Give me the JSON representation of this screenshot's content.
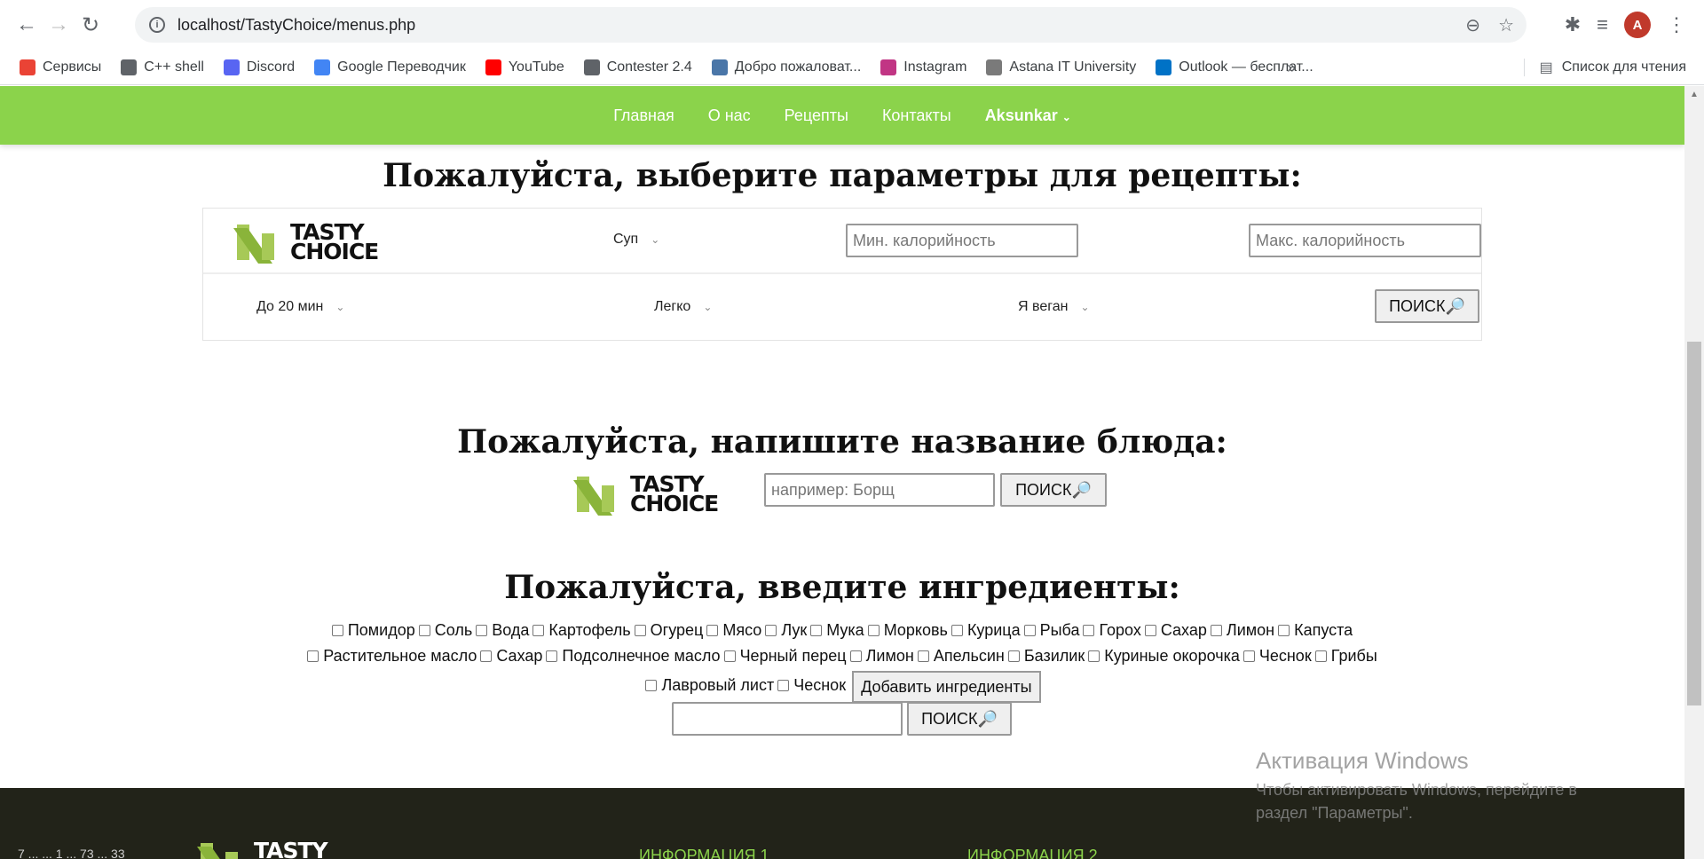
{
  "browser": {
    "url": "localhost/TastyChoice/menus.php",
    "bookmarks": [
      {
        "label": "Сервисы",
        "icon": "apps-grid-icon",
        "color": "#ea4335"
      },
      {
        "label": "C++ shell",
        "icon": "globe-icon",
        "color": "#5f6368"
      },
      {
        "label": "Discord",
        "icon": "discord-icon",
        "color": "#5865f2"
      },
      {
        "label": "Google Переводчик",
        "icon": "google-translate-icon",
        "color": "#4285f4"
      },
      {
        "label": "YouTube",
        "icon": "youtube-icon",
        "color": "#ff0000"
      },
      {
        "label": "Contester 2.4",
        "icon": "globe-icon",
        "color": "#5f6368"
      },
      {
        "label": "Добро пожаловат...",
        "icon": "vk-icon",
        "color": "#4a76a8"
      },
      {
        "label": "Instagram",
        "icon": "instagram-icon",
        "color": "#c13584"
      },
      {
        "label": "Astana IT University",
        "icon": "university-icon",
        "color": "#7a7a7a"
      },
      {
        "label": "Outlook — бесплат...",
        "icon": "outlook-icon",
        "color": "#0072c6"
      }
    ],
    "more": "»",
    "reading_list": "Список для чтения",
    "avatar_letter": "A"
  },
  "nav": {
    "items": [
      "Главная",
      "О нас",
      "Рецепты",
      "Контакты"
    ],
    "user": "Aksunkar"
  },
  "logo": {
    "line1": "TASTY",
    "line2": "CHOICE"
  },
  "params": {
    "title": "Пожалуйста, выберите параметры для рецепты:",
    "dish_type": "Суп",
    "min_cal_placeholder": "Мин. калорийность",
    "max_cal_placeholder": "Макс. калорийность",
    "time": "До 20 мин",
    "difficulty": "Легко",
    "diet": "Я веган",
    "search": "ПОИСК🔎"
  },
  "by_name": {
    "title": "Пожалуйста, напишите название блюда:",
    "placeholder": "например: Борщ",
    "search": "ПОИСК🔎"
  },
  "ingredients": {
    "title": "Пожалуйста, введите ингредиенты:",
    "line1": [
      "Помидор",
      "Соль",
      "Вода",
      "Картофель",
      "Огурец",
      "Мясо",
      "Лук",
      "Мука",
      "Морковь",
      "Курица",
      "Рыба",
      "Горох",
      "Сахар",
      "Лимон",
      "Капуста"
    ],
    "line2": [
      "Растительное масло",
      "Сахар",
      "Подсолнечное масло",
      "Черный перец",
      "Лимон",
      "Апельсин",
      "Базилик",
      "Куриные окорочка",
      "Чеснок",
      "Грибы"
    ],
    "line3": [
      "Лавровый лист",
      "Чеснок"
    ],
    "add_button": "Добавить ингредиенты",
    "search": "ПОИСК🔎"
  },
  "footer": {
    "h1": "ИНФОРМАЦИЯ 1",
    "h2": "ИНФОРМАЦИЯ 2",
    "cut_text": "7 ... ... 1 ... 73 ... 33"
  },
  "windows": {
    "title": "Активация Windows",
    "line1": "Чтобы активировать Windows, перейдите в",
    "line2": "раздел \"Параметры\"."
  }
}
